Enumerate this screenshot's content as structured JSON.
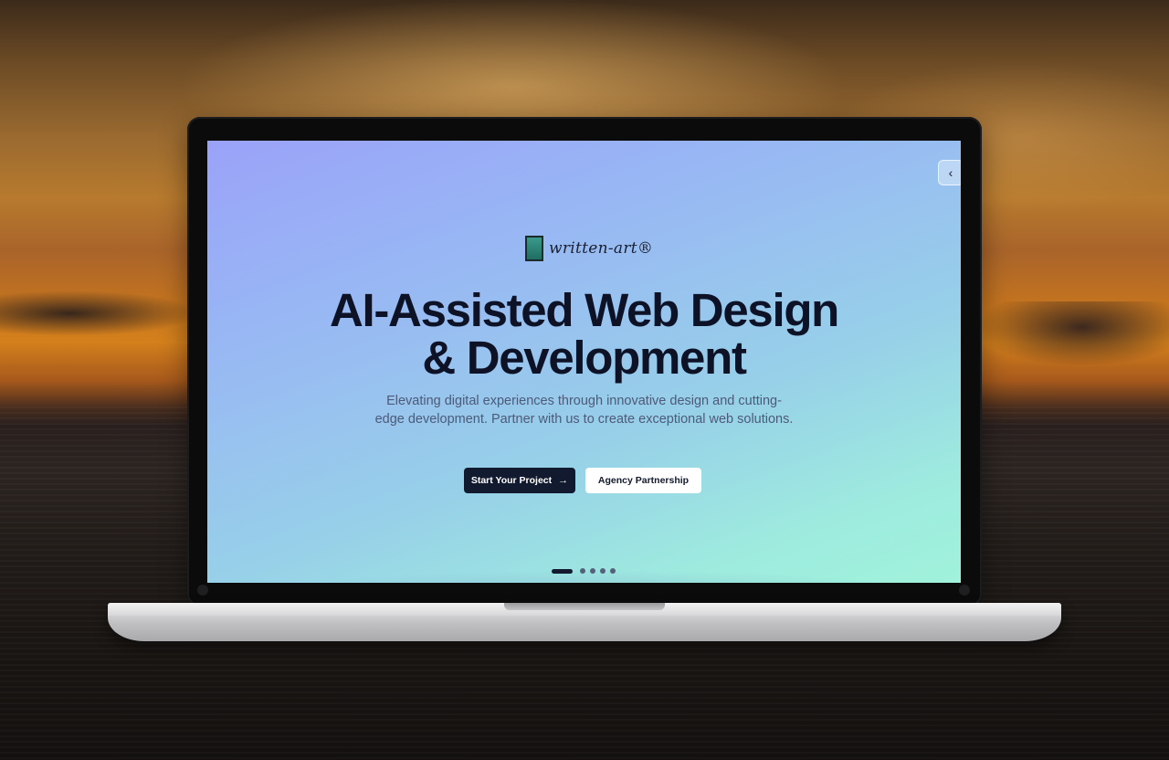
{
  "hero": {
    "brand_name": "written-art®",
    "title_line1": "AI-Assisted Web Design",
    "title_line2": "& Development",
    "subtitle": "Elevating digital experiences through innovative design and cutting-edge development. Partner with us to create exceptional web solutions.",
    "primary_cta": "Start Your Project",
    "primary_cta_icon": "arrow-right-icon",
    "secondary_cta": "Agency Partnership"
  },
  "collapse_tab": {
    "icon": "chevron-left-icon",
    "glyph": "‹"
  },
  "pager": {
    "total": 5,
    "active_index": 0
  },
  "colors": {
    "screen_gradient_start": "#9aa2f8",
    "screen_gradient_end": "#a0f2dc",
    "title": "#0d1226",
    "primary_button": "#111a2e",
    "subtitle": "#4d5a78"
  }
}
